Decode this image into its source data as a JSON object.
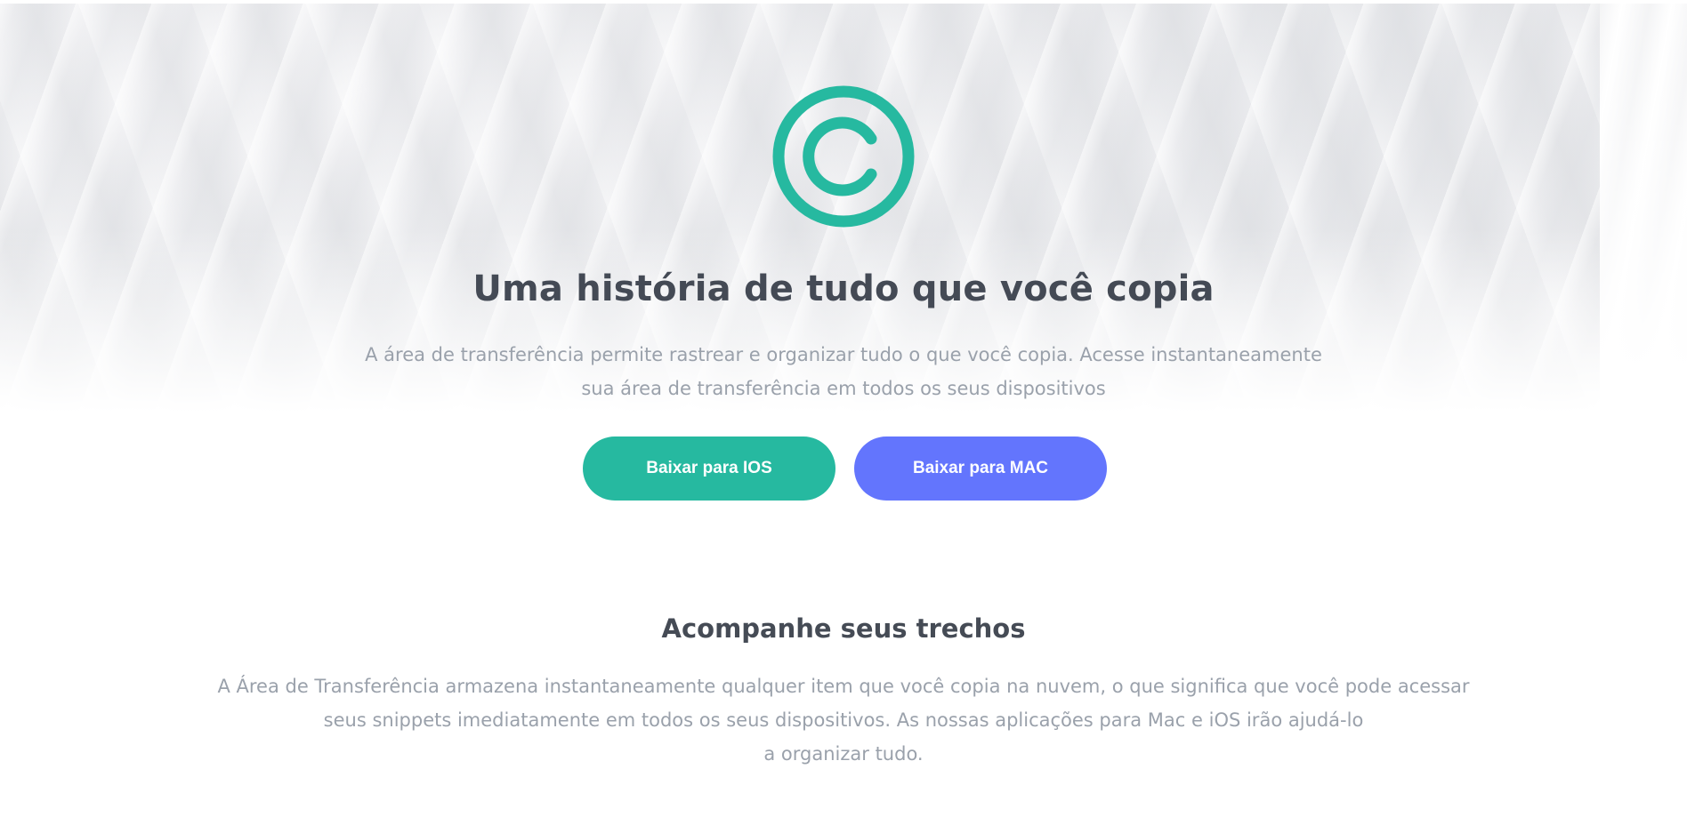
{
  "hero": {
    "logo_icon": "copyright-icon",
    "accent_color": "#26b9a0",
    "title": "Uma história de tudo que você copia",
    "subtitle_line1": "A área de transferência permite rastrear e organizar tudo o que você copia. Acesse instantaneamente",
    "subtitle_line2": "sua área de transferência em todos os seus dispositivos",
    "buttons": {
      "ios_label": "Baixar para IOS",
      "ios_color": "#26b9a0",
      "mac_label": "Baixar para MAC",
      "mac_color": "#6375fd"
    }
  },
  "feature": {
    "title": "Acompanhe seus trechos",
    "text_line1": "A Área de Transferência armazena instantaneamente qualquer item que você copia na nuvem, o que significa que você pode acessar",
    "text_line2": "seus snippets imediatamente em todos os seus dispositivos. As nossas aplicações para Mac e iOS irão ajudá-lo",
    "text_line3": "a organizar tudo."
  }
}
